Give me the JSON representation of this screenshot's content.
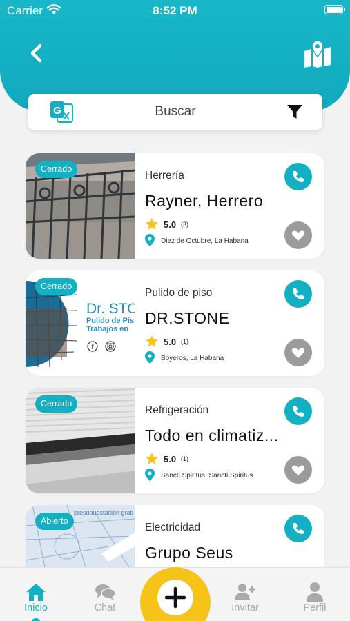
{
  "status_bar": {
    "carrier": "Carrier",
    "time": "8:52 PM"
  },
  "search": {
    "label": "Buscar"
  },
  "listings": [
    {
      "badge": "Cerrado",
      "category": "Herrería",
      "title": "Rayner, Herrero",
      "rating": "5.0",
      "reviews": "(3)",
      "location": "Diez de Octubre, La Habana"
    },
    {
      "badge": "Cerrado",
      "category": "Pulido de piso",
      "title": "DR.STONE",
      "rating": "5.0",
      "reviews": "(1)",
      "location": "Boyeros, La Habana",
      "image_text": {
        "name": "Dr. STO",
        "line1": "Pulido de Pis",
        "line2": "Trabajos en"
      }
    },
    {
      "badge": "Cerrado",
      "category": "Refrigeración",
      "title": "Todo en climatiz...",
      "rating": "5.0",
      "reviews": "(1)",
      "location": "Sancti Spiritus, Sancti Spiritus"
    },
    {
      "badge": "Abierto",
      "category": "Electricidad",
      "title": "Grupo Seus",
      "image_text": {
        "caption": "presupuestación grati"
      }
    }
  ],
  "tabbar": {
    "inicio": "Inicio",
    "chat": "Chat",
    "invitar": "Invitar",
    "perfil": "Perfil"
  },
  "colors": {
    "accent": "#13afc2",
    "add_button": "#f6c319",
    "star": "#f6c319",
    "inactive": "#aaaaaa"
  },
  "icons": [
    "back-arrow-icon",
    "map-icon",
    "translate-icon",
    "filter-icon",
    "phone-icon",
    "heart-icon",
    "star-icon",
    "location-pin-icon",
    "home-icon",
    "chat-icon",
    "plus-icon",
    "add-user-icon",
    "user-icon"
  ]
}
